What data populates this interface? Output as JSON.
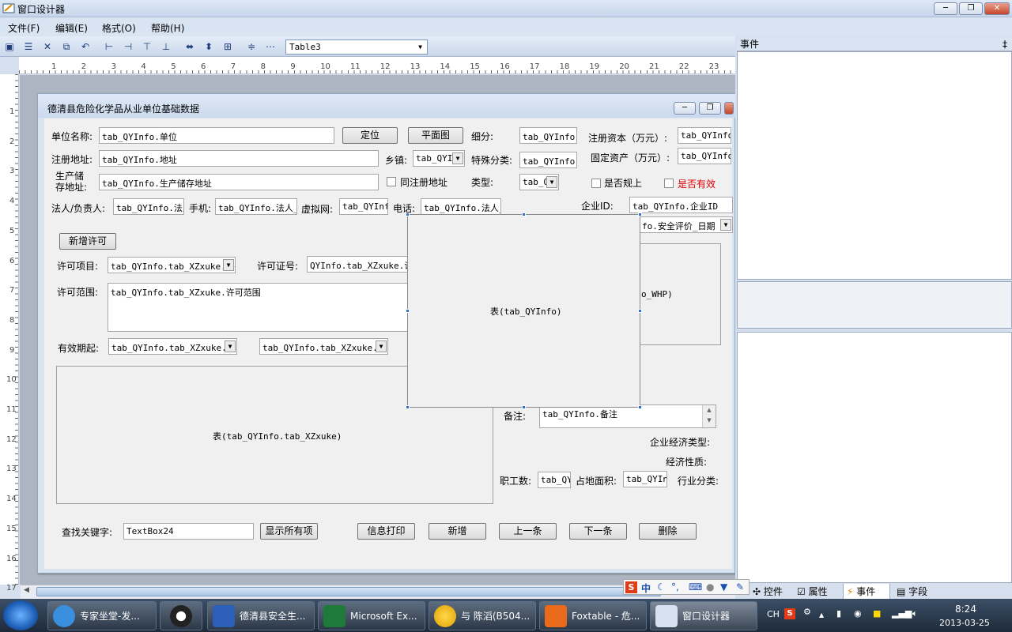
{
  "window": {
    "title": "窗口设计器",
    "btn_min": "─",
    "btn_max": "❐",
    "btn_close": "✕"
  },
  "menu": [
    "文件(F)",
    "编辑(E)",
    "格式(O)",
    "帮助(H)"
  ],
  "toolbar": {
    "table_select": "Table3"
  },
  "ruler_h": [
    "1",
    "2",
    "3",
    "4",
    "5",
    "6",
    "7",
    "8",
    "9",
    "10",
    "11",
    "12",
    "13",
    "14",
    "15",
    "16",
    "17",
    "18",
    "19",
    "20",
    "21",
    "22",
    "23"
  ],
  "ruler_v": [
    "1",
    "2",
    "3",
    "4",
    "5",
    "6",
    "7",
    "8",
    "9",
    "10",
    "11",
    "12",
    "13",
    "14",
    "15",
    "16",
    "17"
  ],
  "form": {
    "title": "德清县危险化学品从业单位基础数据",
    "labels": {
      "unit_name": "单位名称:",
      "reg_addr": "注册地址:",
      "prod_addr": "生产储\n存地址:",
      "legal": "法人/负责人:",
      "mobile": "手机:",
      "virtual": "虚拟网:",
      "phone": "电话:",
      "town": "乡镇:",
      "sub": "细分:",
      "special": "特殊分类:",
      "type": "类型:",
      "capital": "注册资本（万元）:",
      "assets": "固定资产（万元）:",
      "company_id": "企业ID:",
      "same_addr": "同注册地址",
      "above_scale": "是否规上",
      "valid": "是否有效",
      "permit_item": "许可项目:",
      "permit_no": "许可证号:",
      "permit_scope": "许可范围:",
      "valid_from": "有效期起:",
      "remark": "备注:",
      "econ_type": "企业经济类型:",
      "econ_nature": "经济性质:",
      "staff": "职工数:",
      "area": "占地面积:",
      "industry": "行业分类:",
      "search": "查找关键字:"
    },
    "fields": {
      "unit_name": "tab_QYInfo.单位",
      "reg_addr": "tab_QYInfo.地址",
      "prod_addr": "tab_QYInfo.生产储存地址",
      "legal": "tab_QYInfo.法人",
      "mobile": "tab_QYInfo.法人_手",
      "virtual": "tab_QYInfo",
      "phone": "tab_QYInfo.法人_",
      "town": "tab_QYI:",
      "sub": "tab_QYInfo.细",
      "special": "tab_QYInfo.特",
      "type": "tab_Q",
      "capital": "tab_QYInfo.",
      "assets": "tab_QYInfo.",
      "company_id": "tab_QYInfo.企业ID",
      "safety_date": "fo.安全评价_日期",
      "permit_item": "tab_QYInfo.tab_XZxuke.许",
      "permit_no": "QYInfo.tab_XZxuke.许",
      "permit_scope": "tab_QYInfo.tab_XZxuke.许可范围",
      "valid_from": "tab_QYInfo.tab_XZxuke.有",
      "valid_to": "tab_QYInfo.tab_XZxuke.有",
      "remark": "tab_QYInfo.备注",
      "whp": "o_WHP)",
      "staff": "tab_QY.",
      "area": "tab_QYInf",
      "search": "TextBox24"
    },
    "buttons": {
      "locate": "定位",
      "plan": "平面图",
      "add_permit": "新增许可",
      "show_all": "显示所有项",
      "print": "信息打印",
      "add": "新增",
      "prev": "上一条",
      "next": "下一条",
      "delete": "删除"
    },
    "table_main": "表(tab_QYInfo)",
    "table_permit": "表(tab_QYInfo.tab_XZxuke)"
  },
  "right_pane": {
    "header": "事件",
    "pin": "‡",
    "tabs": [
      "控件",
      "属性",
      "事件",
      "字段"
    ]
  },
  "ime": {
    "lang": "中"
  },
  "taskbar": {
    "items": [
      "专家坐堂-发...",
      "",
      "德清县安全生...",
      "Microsoft Ex...",
      "与 陈滔(B504...",
      "Foxtable - 危...",
      "窗口设计器"
    ],
    "tray_lang": "CH",
    "time": "8:24",
    "date": "2013-03-25"
  },
  "colors": {
    "accent": "#2f6fd0",
    "valid_red": "#e00000"
  }
}
